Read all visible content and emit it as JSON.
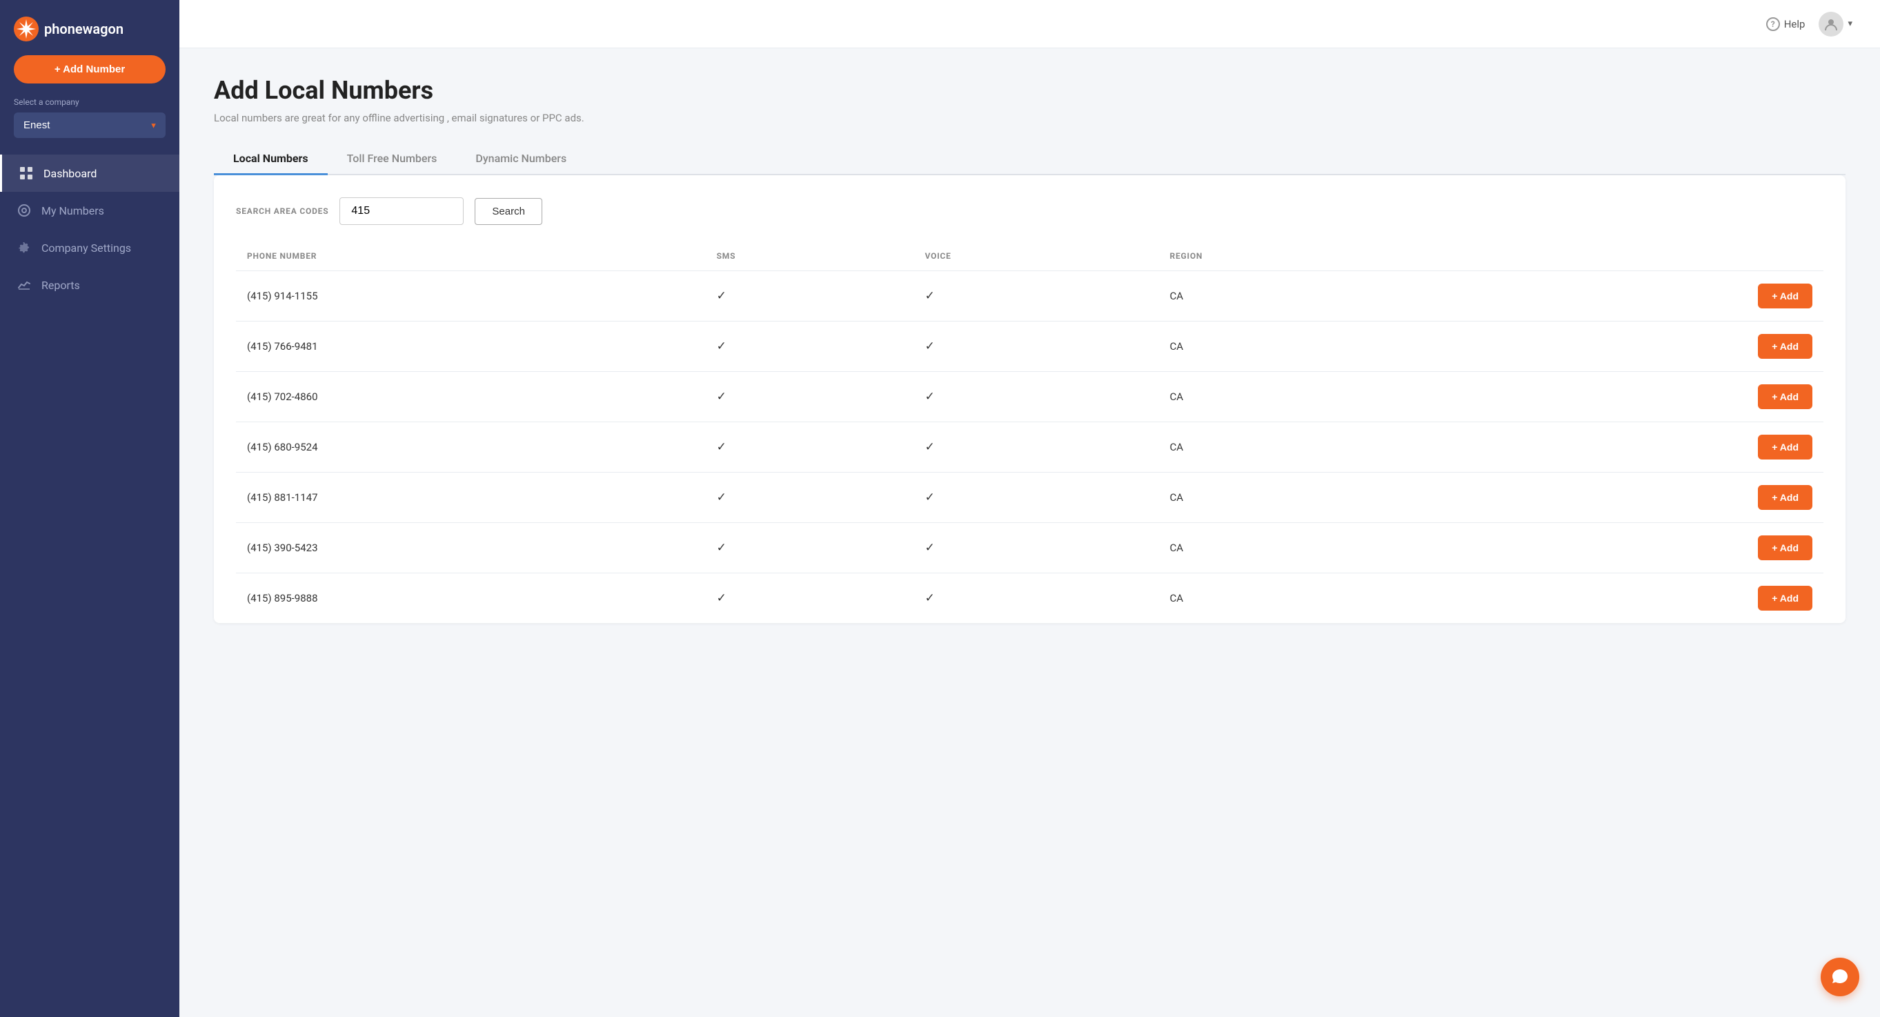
{
  "sidebar": {
    "brand": "phonewagon",
    "add_number_label": "+ Add Number",
    "select_company_label": "Select a company",
    "company_name": "Enest",
    "nav_items": [
      {
        "id": "dashboard",
        "label": "Dashboard",
        "icon": "grid-icon",
        "active": true
      },
      {
        "id": "my-numbers",
        "label": "My Numbers",
        "icon": "phone-icon",
        "active": false
      },
      {
        "id": "company-settings",
        "label": "Company Settings",
        "icon": "gear-icon",
        "active": false
      },
      {
        "id": "reports",
        "label": "Reports",
        "icon": "chart-icon",
        "active": false
      }
    ]
  },
  "topbar": {
    "help_label": "Help",
    "help_icon_text": "?",
    "user_chevron": "▾"
  },
  "page": {
    "title": "Add Local Numbers",
    "subtitle": "Local numbers are great for any offline advertising , email signatures or PPC ads."
  },
  "tabs": [
    {
      "id": "local",
      "label": "Local Numbers",
      "active": true
    },
    {
      "id": "toll-free",
      "label": "Toll Free Numbers",
      "active": false
    },
    {
      "id": "dynamic",
      "label": "Dynamic Numbers",
      "active": false
    }
  ],
  "search": {
    "area_codes_label": "SEARCH AREA CODES",
    "input_value": "415",
    "button_label": "Search"
  },
  "table": {
    "columns": [
      {
        "id": "phone",
        "label": "PHONE NUMBER"
      },
      {
        "id": "sms",
        "label": "SMS"
      },
      {
        "id": "voice",
        "label": "VOICE"
      },
      {
        "id": "region",
        "label": "REGION"
      },
      {
        "id": "action",
        "label": ""
      }
    ],
    "rows": [
      {
        "phone": "(415) 914-1155",
        "sms": true,
        "voice": true,
        "region": "CA"
      },
      {
        "phone": "(415) 766-9481",
        "sms": true,
        "voice": true,
        "region": "CA"
      },
      {
        "phone": "(415) 702-4860",
        "sms": true,
        "voice": true,
        "region": "CA"
      },
      {
        "phone": "(415) 680-9524",
        "sms": true,
        "voice": true,
        "region": "CA"
      },
      {
        "phone": "(415) 881-1147",
        "sms": true,
        "voice": true,
        "region": "CA"
      },
      {
        "phone": "(415) 390-5423",
        "sms": true,
        "voice": true,
        "region": "CA"
      },
      {
        "phone": "(415) 895-9888",
        "sms": true,
        "voice": true,
        "region": "CA"
      }
    ],
    "add_btn_label": "+ Add"
  }
}
